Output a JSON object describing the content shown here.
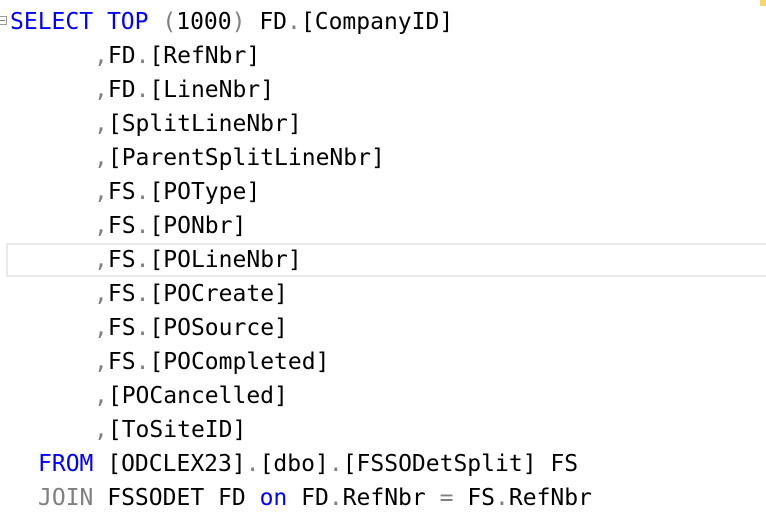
{
  "editor": {
    "lines": [
      {
        "indent": 10,
        "tokens": [
          {
            "t": "SELECT",
            "c": "kw"
          },
          {
            "t": " "
          },
          {
            "t": "TOP",
            "c": "kw"
          },
          {
            "t": " "
          },
          {
            "t": "(",
            "c": "gray"
          },
          {
            "t": "1000"
          },
          {
            "t": ")",
            "c": "gray"
          },
          {
            "t": " FD"
          },
          {
            "t": ".",
            "c": "gray"
          },
          {
            "t": "[CompanyID]"
          }
        ]
      },
      {
        "indent": 94,
        "tokens": [
          {
            "t": ",",
            "c": "gray"
          },
          {
            "t": "FD"
          },
          {
            "t": ".",
            "c": "gray"
          },
          {
            "t": "[RefNbr]"
          }
        ]
      },
      {
        "indent": 94,
        "tokens": [
          {
            "t": ",",
            "c": "gray"
          },
          {
            "t": "FD"
          },
          {
            "t": ".",
            "c": "gray"
          },
          {
            "t": "[LineNbr]"
          }
        ]
      },
      {
        "indent": 94,
        "tokens": [
          {
            "t": ",",
            "c": "gray"
          },
          {
            "t": "[SplitLineNbr]"
          }
        ]
      },
      {
        "indent": 94,
        "tokens": [
          {
            "t": ",",
            "c": "gray"
          },
          {
            "t": "[ParentSplitLineNbr]"
          }
        ]
      },
      {
        "indent": 94,
        "tokens": [
          {
            "t": ",",
            "c": "gray"
          },
          {
            "t": "FS"
          },
          {
            "t": ".",
            "c": "gray"
          },
          {
            "t": "[POType]"
          }
        ]
      },
      {
        "indent": 94,
        "tokens": [
          {
            "t": ",",
            "c": "gray"
          },
          {
            "t": "FS"
          },
          {
            "t": ".",
            "c": "gray"
          },
          {
            "t": "[PONbr]"
          }
        ]
      },
      {
        "indent": 94,
        "tokens": [
          {
            "t": ",",
            "c": "gray"
          },
          {
            "t": "FS"
          },
          {
            "t": ".",
            "c": "gray"
          },
          {
            "t": "[POLineNbr]"
          }
        ]
      },
      {
        "indent": 94,
        "tokens": [
          {
            "t": ",",
            "c": "gray"
          },
          {
            "t": "FS"
          },
          {
            "t": ".",
            "c": "gray"
          },
          {
            "t": "[POCreate]"
          }
        ]
      },
      {
        "indent": 94,
        "tokens": [
          {
            "t": ",",
            "c": "gray"
          },
          {
            "t": "FS"
          },
          {
            "t": ".",
            "c": "gray"
          },
          {
            "t": "[POSource]"
          }
        ]
      },
      {
        "indent": 94,
        "tokens": [
          {
            "t": ",",
            "c": "gray"
          },
          {
            "t": "FS"
          },
          {
            "t": ".",
            "c": "gray"
          },
          {
            "t": "[POCompleted]"
          }
        ]
      },
      {
        "indent": 94,
        "tokens": [
          {
            "t": ",",
            "c": "gray"
          },
          {
            "t": "[POCancelled]"
          }
        ]
      },
      {
        "indent": 94,
        "tokens": [
          {
            "t": ",",
            "c": "gray"
          },
          {
            "t": "[ToSiteID]"
          }
        ]
      },
      {
        "indent": 38,
        "tokens": [
          {
            "t": "FROM",
            "c": "kw"
          },
          {
            "t": " [ODCLEX23]"
          },
          {
            "t": ".",
            "c": "gray"
          },
          {
            "t": "[dbo]"
          },
          {
            "t": ".",
            "c": "gray"
          },
          {
            "t": "[FSSODetSplit] FS"
          }
        ]
      },
      {
        "indent": 38,
        "tokens": [
          {
            "t": "JOIN",
            "c": "gray"
          },
          {
            "t": " FSSODET FD "
          },
          {
            "t": "on",
            "c": "kw"
          },
          {
            "t": " FD"
          },
          {
            "t": ".",
            "c": "gray"
          },
          {
            "t": "RefNbr "
          },
          {
            "t": "=",
            "c": "gray"
          },
          {
            "t": " FS"
          },
          {
            "t": ".",
            "c": "gray"
          },
          {
            "t": "RefNbr"
          }
        ]
      }
    ],
    "current_line_index": 7,
    "colors": {
      "keyword": "#0000ff",
      "operator": "#808080",
      "text": "#000000",
      "current_line_border": "#eaeaea"
    }
  }
}
